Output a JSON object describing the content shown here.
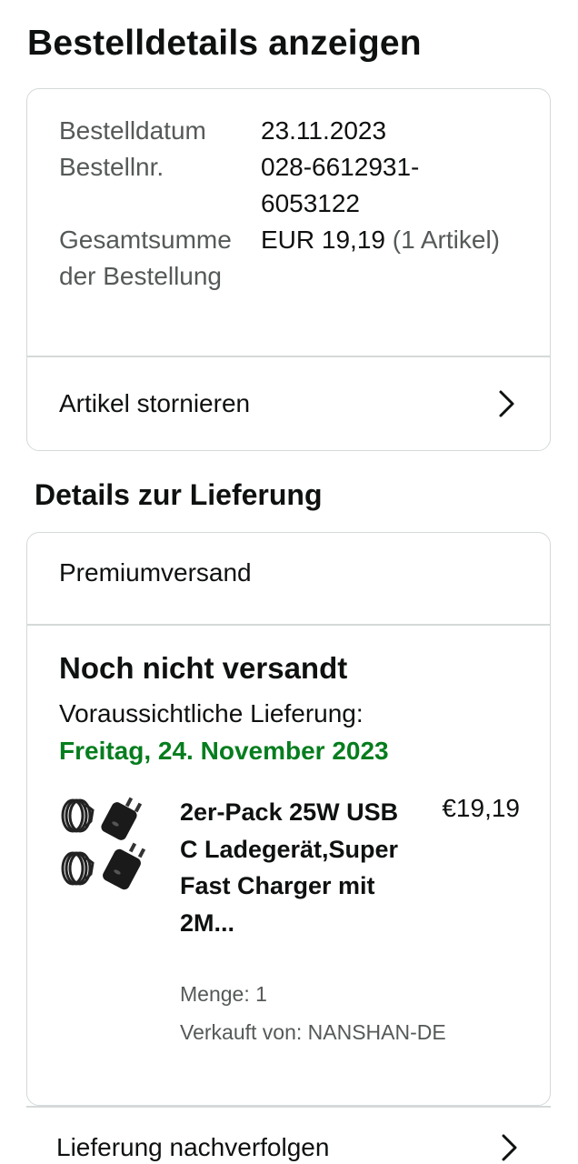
{
  "page": {
    "title": "Bestelldetails anzeigen"
  },
  "order": {
    "date_label": "Bestelldatum",
    "date_value": "23.11.2023",
    "number_label": "Bestellnr.",
    "number_value": "028-6612931-6053122",
    "total_label": "Gesamtsumme der Bestellung",
    "total_value": "EUR 19,19",
    "total_items": "(1 Artikel)",
    "cancel_label": "Artikel stornieren"
  },
  "delivery": {
    "section_title": "Details zur Lieferung",
    "shipping_method": "Premiumversand",
    "status": "Noch nicht versandt",
    "expected_label": "Voraussichtliche Lieferung:",
    "expected_date": "Freitag, 24. November 2023",
    "status_color": "#067d1e",
    "product": {
      "title": "2er-Pack 25W USB C Ladegerät,Super Fast Charger mit 2M...",
      "price": "€19,19",
      "quantity": "Menge: 1",
      "seller": "Verkauft von: NANSHAN-DE",
      "image_icon": "usb-c-charger-image"
    },
    "track_label": "Lieferung nachverfolgen"
  },
  "icons": {
    "chevron": "chevron-right-icon"
  }
}
